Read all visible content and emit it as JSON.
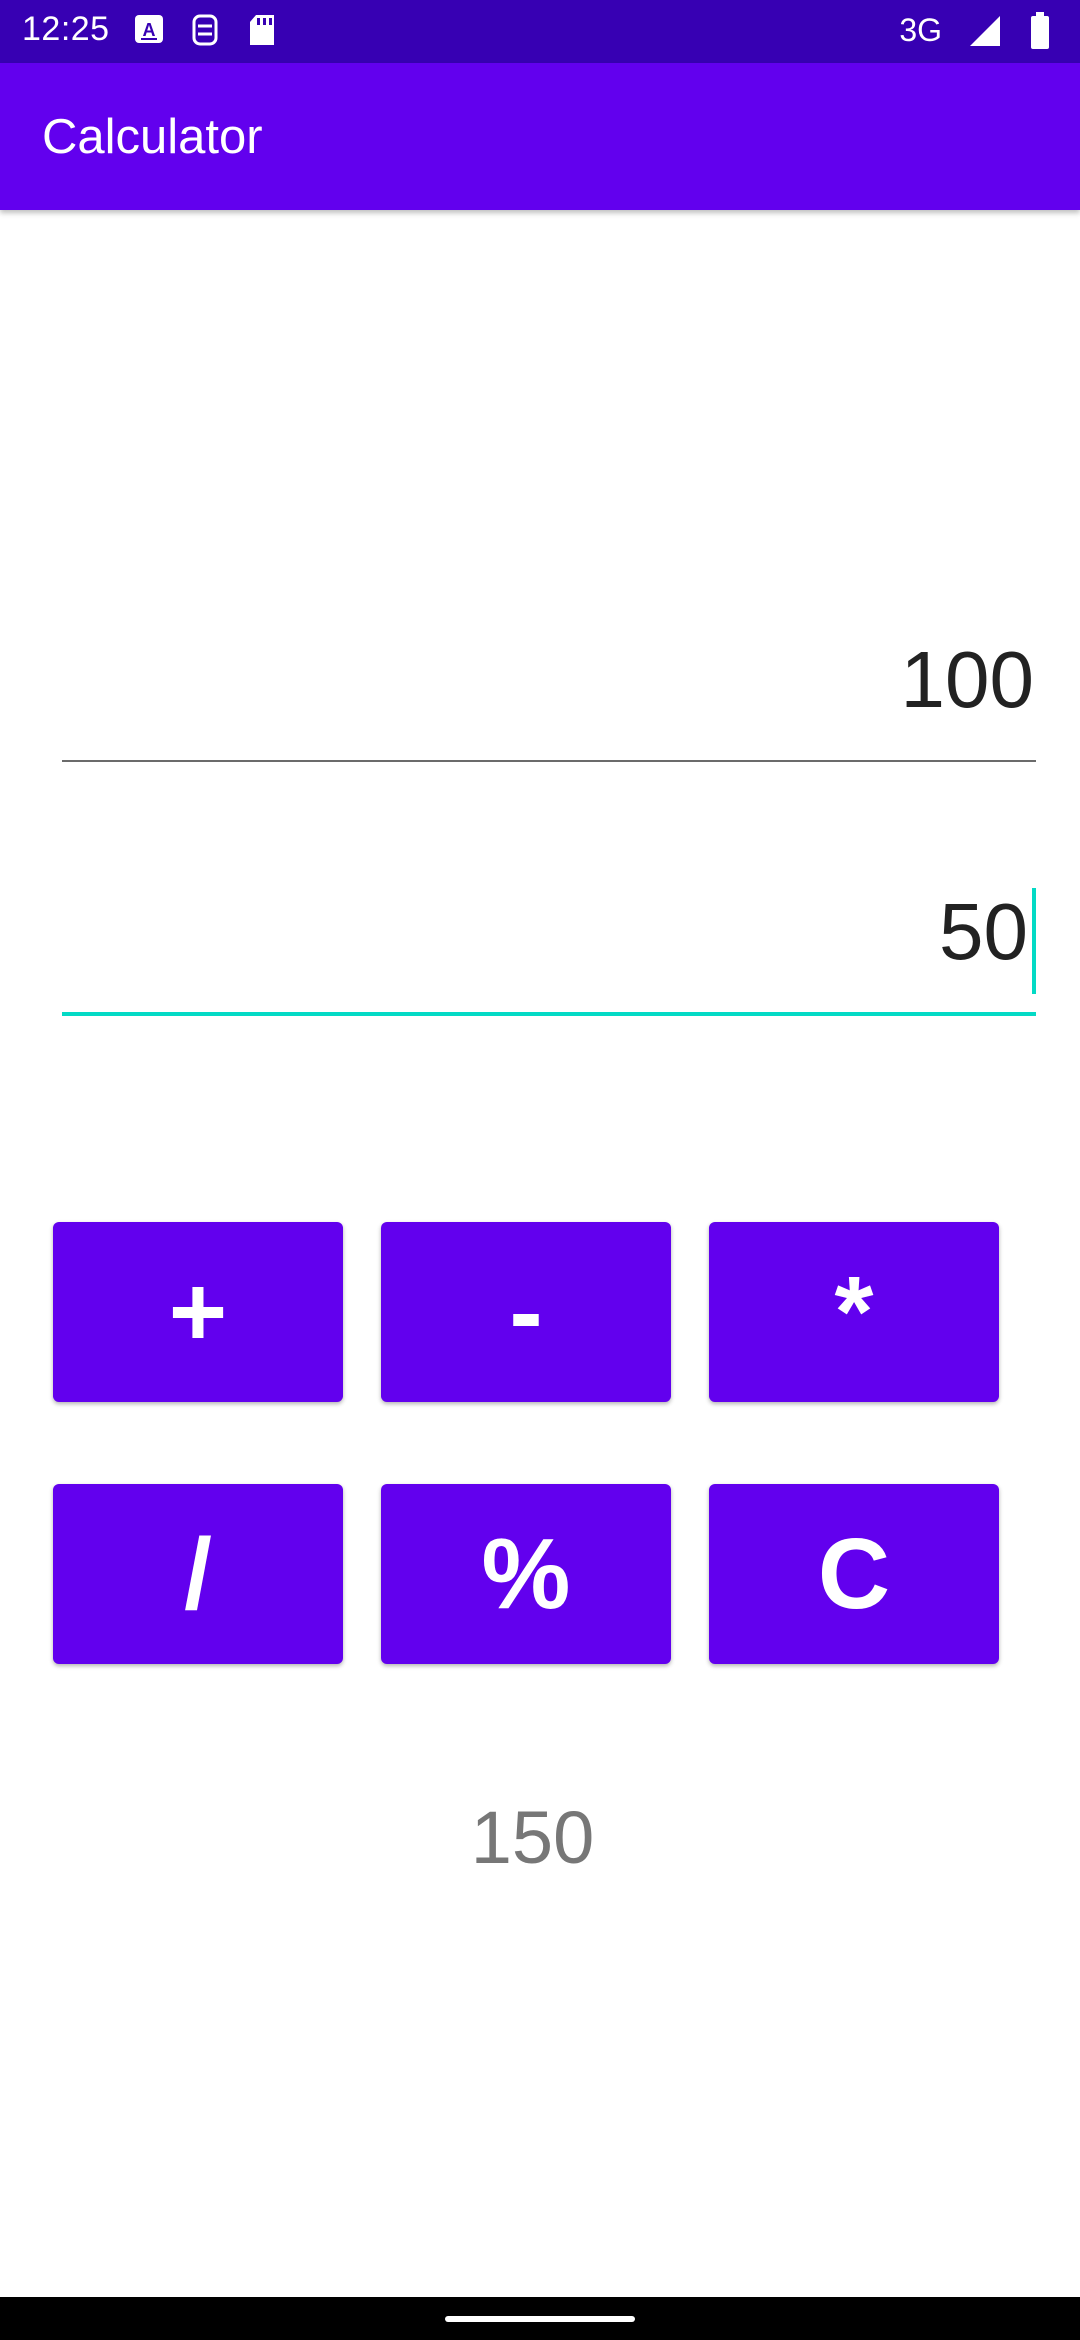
{
  "status_bar": {
    "time": "12:25",
    "network": "3G",
    "icons": [
      "keyboard-a-icon",
      "accessibility-icon",
      "sd-card-icon",
      "signal-icon",
      "battery-icon"
    ]
  },
  "app_bar": {
    "title": "Calculator"
  },
  "inputs": {
    "first_number": "100",
    "second_number": "50"
  },
  "operations": {
    "add": "+",
    "subtract": "-",
    "multiply": "*",
    "divide": "/",
    "percent": "%",
    "clear": "C"
  },
  "result": "150",
  "colors": {
    "status_bar": "#3700B3",
    "primary": "#6200EE",
    "accent": "#03DAC5"
  }
}
